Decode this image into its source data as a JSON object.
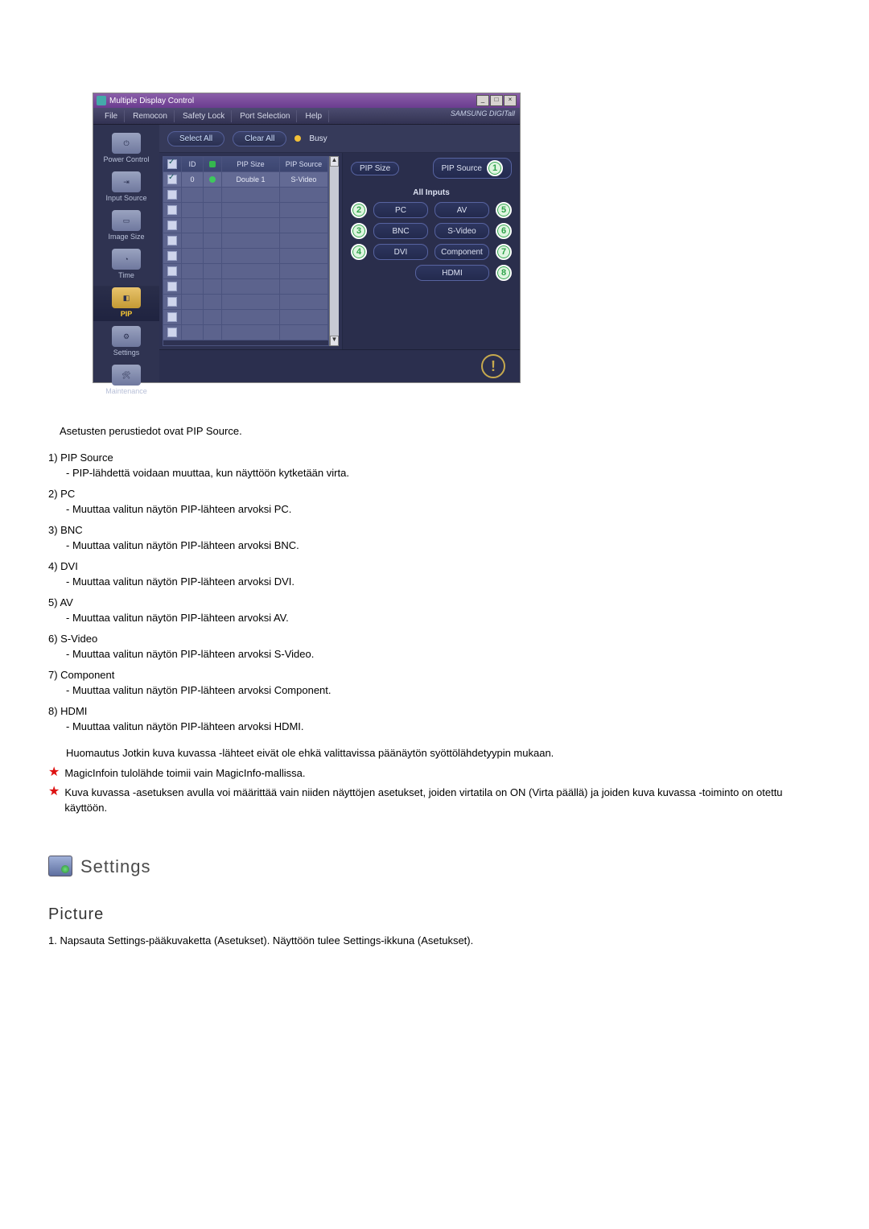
{
  "window": {
    "title": "Multiple Display Control",
    "btn_min": "_",
    "btn_max": "□",
    "btn_close": "×"
  },
  "menu": {
    "items": [
      "File",
      "Remocon",
      "Safety Lock",
      "Port Selection",
      "Help"
    ],
    "brand": "SAMSUNG DIGITall"
  },
  "sidebar": {
    "items": [
      {
        "label": "Power Control"
      },
      {
        "label": "Input Source"
      },
      {
        "label": "Image Size"
      },
      {
        "label": "Time"
      },
      {
        "label": "PIP"
      },
      {
        "label": "Settings"
      },
      {
        "label": "Maintenance"
      }
    ]
  },
  "toolbar": {
    "select_all": "Select All",
    "clear_all": "Clear All",
    "busy": "Busy"
  },
  "grid": {
    "headers": {
      "id": "ID",
      "size": "PIP Size",
      "source": "PIP Source"
    },
    "row": {
      "id": "0",
      "size": "Double 1",
      "source": "S-Video"
    },
    "empty_rows": 10
  },
  "right": {
    "head_left": "PIP Size",
    "head_right": "PIP Source",
    "head_right_num": "1",
    "all_inputs": "All Inputs",
    "left": [
      {
        "num": "2",
        "label": "PC"
      },
      {
        "num": "3",
        "label": "BNC"
      },
      {
        "num": "4",
        "label": "DVI"
      }
    ],
    "right_col": [
      {
        "num": "5",
        "label": "AV"
      },
      {
        "num": "6",
        "label": "S-Video"
      },
      {
        "num": "7",
        "label": "Component"
      },
      {
        "num": "8",
        "label": "HDMI"
      }
    ]
  },
  "info_glyph": "!",
  "doc": {
    "intro": "Asetusten perustiedot ovat PIP Source.",
    "items": [
      {
        "n": "1",
        "t": "PIP Source",
        "d": "- PIP-lähdettä voidaan muuttaa, kun näyttöön kytketään virta."
      },
      {
        "n": "2",
        "t": "PC",
        "d": "- Muuttaa valitun näytön PIP-lähteen arvoksi PC."
      },
      {
        "n": "3",
        "t": "BNC",
        "d": "- Muuttaa valitun näytön PIP-lähteen arvoksi BNC."
      },
      {
        "n": "4",
        "t": "DVI",
        "d": "- Muuttaa valitun näytön PIP-lähteen arvoksi DVI."
      },
      {
        "n": "5",
        "t": "AV",
        "d": "- Muuttaa valitun näytön PIP-lähteen arvoksi AV."
      },
      {
        "n": "6",
        "t": "S-Video",
        "d": "- Muuttaa valitun näytön PIP-lähteen arvoksi S-Video."
      },
      {
        "n": "7",
        "t": "Component",
        "d": "- Muuttaa valitun näytön PIP-lähteen arvoksi Component."
      },
      {
        "n": "8",
        "t": "HDMI",
        "d": "- Muuttaa valitun näytön PIP-lähteen arvoksi HDMI."
      }
    ],
    "note": "Huomautus Jotkin kuva kuvassa -lähteet eivät ole ehkä valittavissa päänäytön syöttölähdetyypin mukaan.",
    "star1": "MagicInfoin tulolähde toimii vain MagicInfo-mallissa.",
    "star2": "Kuva kuvassa -asetuksen avulla voi määrittää vain niiden näyttöjen asetukset, joiden virtatila on ON (Virta päällä) ja joiden kuva kuvassa -toiminto on otettu käyttöön.",
    "section": "Settings",
    "subsection": "Picture",
    "sub_step1": "1.  Napsauta Settings-pääkuvaketta (Asetukset). Näyttöön tulee Settings-ikkuna (Asetukset)."
  }
}
